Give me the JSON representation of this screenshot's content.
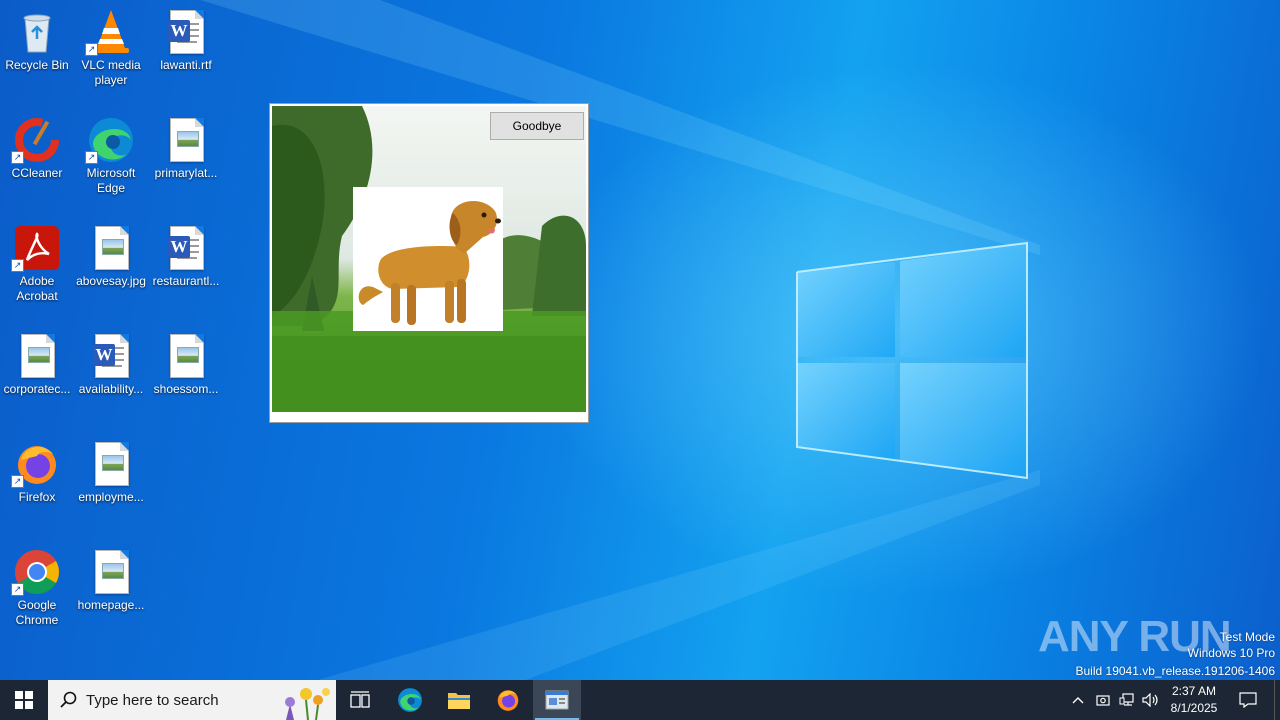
{
  "desktop": {
    "icons": [
      {
        "label": "Recycle Bin"
      },
      {
        "label": "VLC media player"
      },
      {
        "label": "lawanti.rtf"
      },
      {
        "label": "CCleaner"
      },
      {
        "label": "Microsoft Edge"
      },
      {
        "label": "primarylat..."
      },
      {
        "label": "Adobe Acrobat"
      },
      {
        "label": "abovesay.jpg"
      },
      {
        "label": "restaurantl..."
      },
      {
        "label": "corporatec..."
      },
      {
        "label": "availability..."
      },
      {
        "label": "shoessom..."
      },
      {
        "label": "Firefox"
      },
      {
        "label": "employme..."
      },
      {
        "label": "Google Chrome"
      },
      {
        "label": "homepage..."
      }
    ],
    "watermark": {
      "line1": "Test Mode",
      "line2": "Windows 10 Pro",
      "line3": "Build 19041.vb_release.191206-1406"
    },
    "brand": "ANY RUN"
  },
  "app_window": {
    "button_label": "Goodbye",
    "image": "dog-on-grass-image"
  },
  "taskbar": {
    "search_placeholder": "Type here to search",
    "pinned": [
      "task-view-icon",
      "edge-icon",
      "file-explorer-icon",
      "firefox-icon",
      "running-app-icon"
    ],
    "clock": {
      "time": "2:37 AM",
      "date": "8/1/2025"
    }
  },
  "colors": {
    "taskbar": "#1d2634",
    "desktop_blue": "#0a78e0",
    "accent": "#76b9ed"
  }
}
